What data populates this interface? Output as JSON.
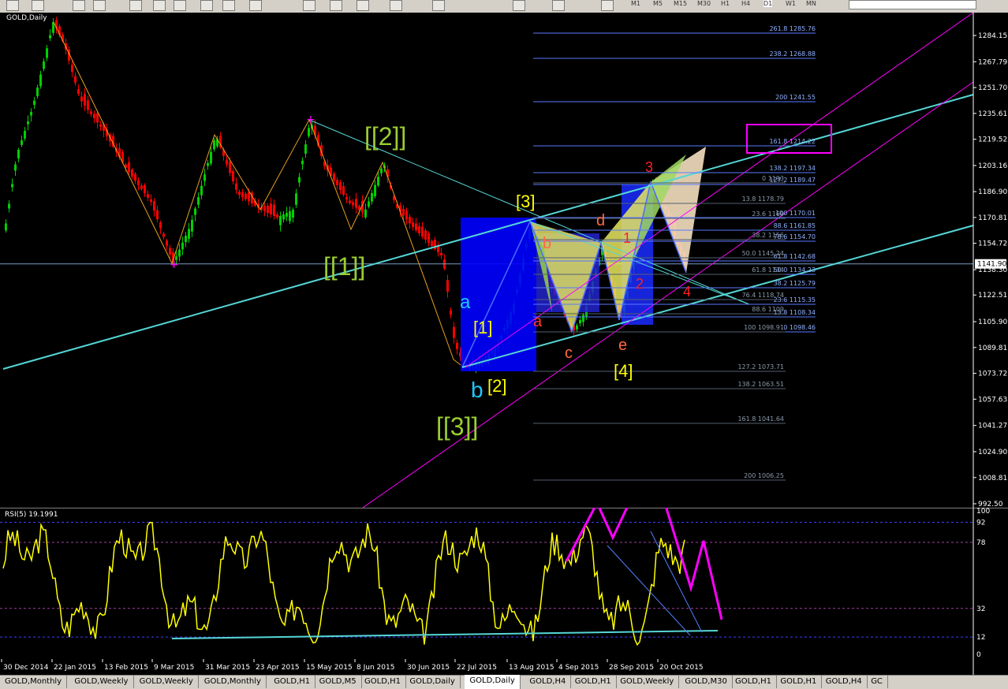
{
  "window": {
    "symbol_title": "GOLD,Daily"
  },
  "toolbar": {
    "timeframes": [
      "M1",
      "M5",
      "M15",
      "M30",
      "H1",
      "H4",
      "D1",
      "W1",
      "MN"
    ]
  },
  "price_axis": {
    "ticks": [
      "1284.15",
      "1267.79",
      "1251.70",
      "1235.61",
      "1219.52",
      "1203.16",
      "1186.90",
      "1170.81",
      "1154.72",
      "1138.30",
      "1122.51",
      "1105.90",
      "1089.81",
      "1073.72",
      "1057.63",
      "1041.27",
      "1024.90",
      "1008.81",
      "992.50"
    ],
    "current_price": "1141.90"
  },
  "date_axis": {
    "ticks": [
      "30 Dec 2014",
      "22 Jan 2015",
      "13 Feb 2015",
      "9 Mar 2015",
      "31 Mar 2015",
      "23 Apr 2015",
      "15 May 2015",
      "8 Jun 2015",
      "30 Jun 2015",
      "22 Jul 2015",
      "13 Aug 2015",
      "4 Sep 2015",
      "28 Sep 2015",
      "20 Oct 2015"
    ]
  },
  "fib_left": {
    "levels": [
      "261.8 1285.76",
      "238.2 1268.88",
      "200 1241.55",
      "161.8 1214.22",
      "138.2 1197.34",
      "127.2 1189.47",
      "100 1170.01",
      "88.6 1161.85",
      "78.6 1154.70",
      "61.8 1142.68",
      "50.0 1134.23",
      "38.2 1125.79",
      "23.6 1115.35",
      "13.8 1108.34",
      "0 1098.46"
    ]
  },
  "fib_right": {
    "levels": [
      "0 1193",
      "13.8 1178.79",
      "23.6 1169",
      "38.2 1156",
      "50.0 1145.24",
      "61.8 1134",
      "76.4 1118.74",
      "88.6 1109",
      "100 1098.91",
      "127.2 1073.71",
      "138.2 1063.51",
      "161.8 1041.64",
      "200 1006.25"
    ]
  },
  "wave_labels": {
    "w2": "[[2]]",
    "w1": "[[1]]",
    "w3": "[[3]]",
    "s3": "[3]",
    "s1": "[1]",
    "s2": "[2]",
    "s4": "[4]",
    "a_blue": "a",
    "b_blue": "b",
    "a_red": "a",
    "b_red": "b",
    "c_red": "c",
    "d_red": "d",
    "e_red": "e",
    "r1": "1",
    "r2": "2",
    "r3": "3",
    "r4": "4"
  },
  "rsi": {
    "title": "RSI(5) 19.1991",
    "levels": [
      "100",
      "92",
      "78",
      "32",
      "12",
      "0"
    ]
  },
  "tabs": [
    "GOLD,Monthly",
    "GOLD,Weekly",
    "GOLD,Weekly",
    "GOLD,Monthly",
    "GOLD,H1",
    "GOLD,M5",
    "GOLD,H1",
    "GOLD,Daily",
    "GOLD,Daily",
    "GOLD,H4",
    "GOLD,H1",
    "GOLD,Weekly",
    "GOLD,M30",
    "GOLD,H1",
    "GOLD,H1",
    "GOLD,H4",
    "GC"
  ],
  "active_tab_index": 8,
  "colors": {
    "bull": "#00d000",
    "bear": "#ff0000",
    "channel": "#55d6d6",
    "magenta": "#ff00ff",
    "fib": "#5a78ff",
    "wave_green": "#9acd32",
    "rsi": "#ffff00"
  }
}
